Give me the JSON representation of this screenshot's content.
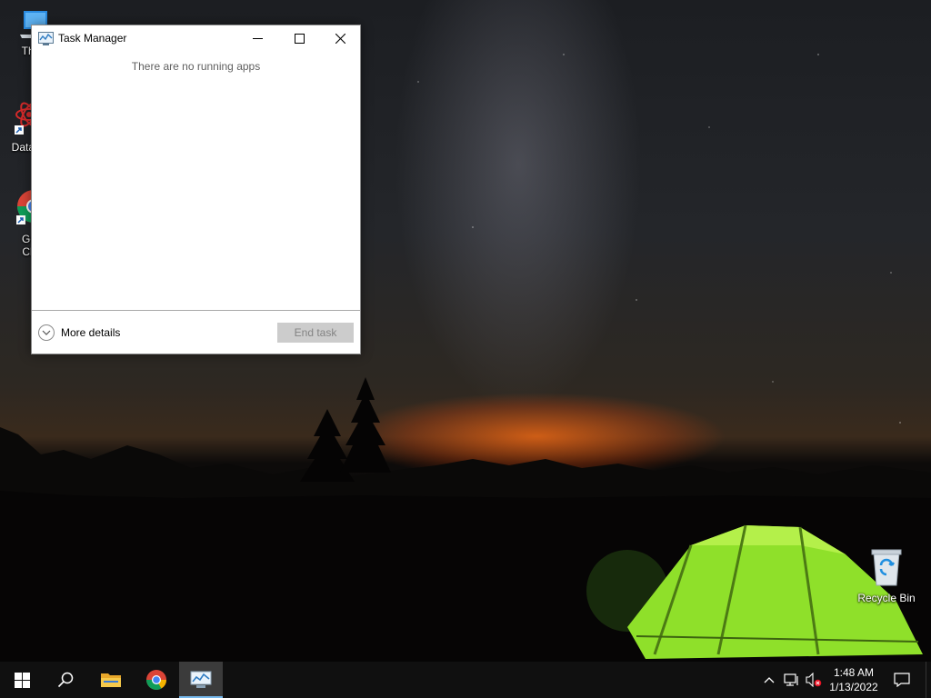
{
  "desktop": {
    "icons": [
      {
        "label": "This PC",
        "visible_label": "Thi"
      },
      {
        "label": "DataWrangler",
        "visible_label": "DataW"
      },
      {
        "label": "Google Chrome",
        "visible_label_line1": "Go",
        "visible_label_line2": "Ch"
      },
      {
        "label": "Recycle Bin"
      }
    ]
  },
  "task_manager": {
    "title": "Task Manager",
    "empty_message": "There are no running apps",
    "more_details_label": "More details",
    "end_task_label": "End task",
    "end_task_enabled": false
  },
  "taskbar": {
    "pinned": [
      {
        "name": "start",
        "icon": "windows-logo-icon"
      },
      {
        "name": "search",
        "icon": "search-icon"
      },
      {
        "name": "file-explorer",
        "icon": "folder-icon"
      },
      {
        "name": "chrome",
        "icon": "chrome-icon"
      },
      {
        "name": "task-manager",
        "icon": "task-manager-icon",
        "active": true
      }
    ],
    "tray": {
      "time": "1:48 AM",
      "date": "1/13/2022",
      "volume_muted": true
    }
  },
  "colors": {
    "taskbar_bg": "#101010",
    "active_indicator": "#76b9ed",
    "tent_green": "#8fe02a"
  }
}
